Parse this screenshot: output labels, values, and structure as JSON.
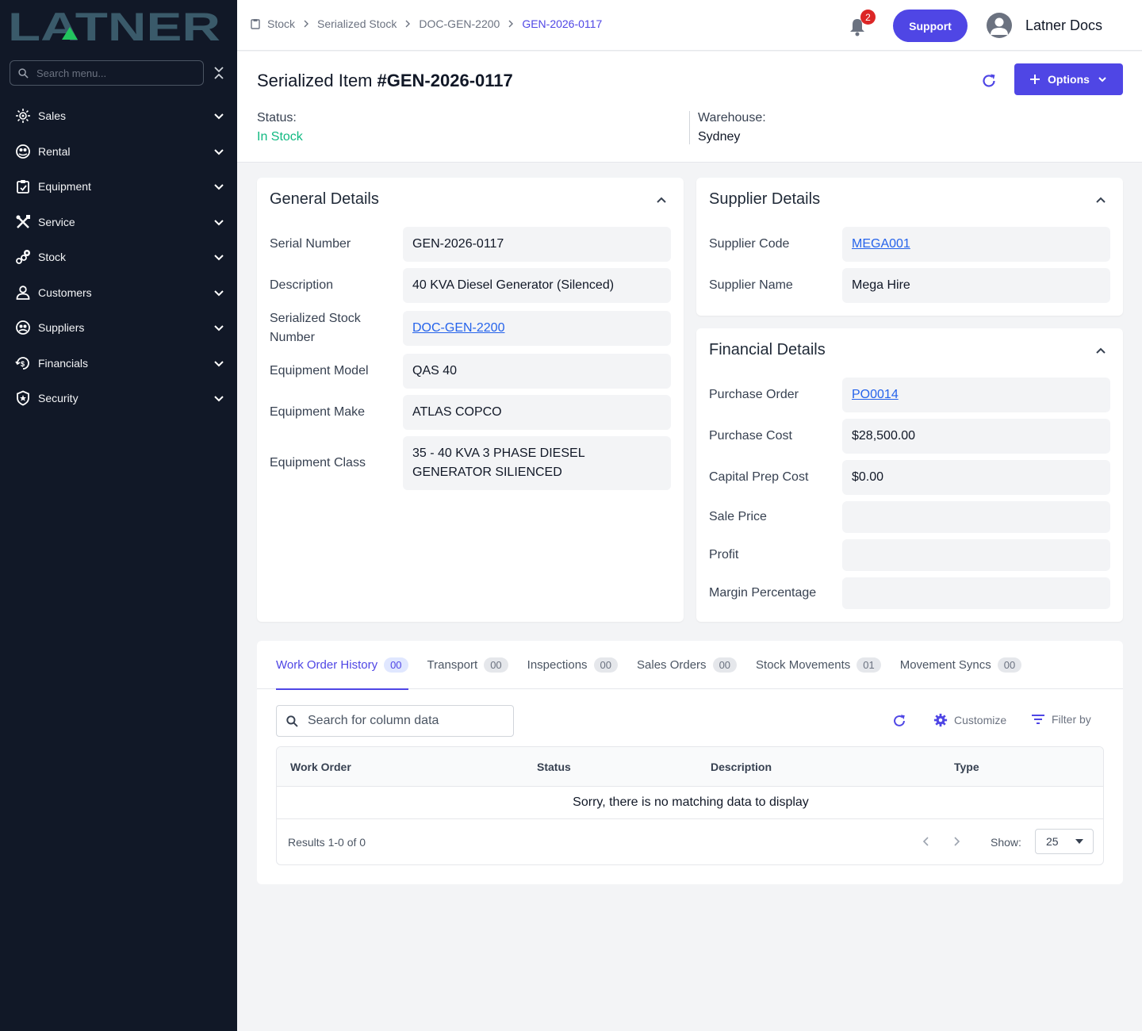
{
  "app": {
    "logo_text": "LATNER",
    "menu_search_placeholder": "Search menu..."
  },
  "sidebar": {
    "items": [
      {
        "label": "Sales",
        "icon": "sales-icon"
      },
      {
        "label": "Rental",
        "icon": "rental-icon"
      },
      {
        "label": "Equipment",
        "icon": "equipment-icon"
      },
      {
        "label": "Service",
        "icon": "service-tools-icon"
      },
      {
        "label": "Stock",
        "icon": "stock-icon"
      },
      {
        "label": "Customers",
        "icon": "user-icon"
      },
      {
        "label": "Suppliers",
        "icon": "suppliers-icon"
      },
      {
        "label": "Financials",
        "icon": "financials-icon"
      },
      {
        "label": "Security",
        "icon": "shield-icon"
      }
    ]
  },
  "topbar": {
    "breadcrumb": [
      "Stock",
      "Serialized Stock",
      "DOC-GEN-2200",
      "GEN-2026-0117"
    ],
    "notification_count": "2",
    "support_label": "Support",
    "user_name": "Latner Docs"
  },
  "header": {
    "title": "Serialized Item",
    "number": "#GEN-2026-0117",
    "options_label": "Options",
    "status_label": "Status:",
    "status_value": "In Stock",
    "warehouse_label": "Warehouse:",
    "warehouse_value": "Sydney"
  },
  "general": {
    "title": "General Details",
    "fields": [
      {
        "label": "Serial Number",
        "value": "GEN-2026-0117"
      },
      {
        "label": "Description",
        "value": "40 KVA Diesel Generator (Silenced)"
      },
      {
        "label": "Serialized Stock Number",
        "value": "DOC-GEN-2200"
      },
      {
        "label": "Equipment Model",
        "value": "QAS 40"
      },
      {
        "label": "Equipment Make",
        "value": "ATLAS COPCO"
      },
      {
        "label": "Equipment Class",
        "value": "35 - 40 KVA 3 PHASE DIESEL GENERATOR SILIENCED"
      }
    ]
  },
  "supplier": {
    "title": "Supplier Details",
    "fields": [
      {
        "label": "Supplier Code",
        "value": "MEGA001"
      },
      {
        "label": "Supplier Name",
        "value": "Mega Hire"
      }
    ]
  },
  "financial": {
    "title": "Financial Details",
    "fields": [
      {
        "label": "Purchase Order",
        "value": "PO0014"
      },
      {
        "label": "Purchase Cost",
        "value": "$28,500.00"
      },
      {
        "label": "Capital Prep Cost",
        "value": "$0.00"
      },
      {
        "label": "Sale Price",
        "value": ""
      },
      {
        "label": "Profit",
        "value": ""
      },
      {
        "label": "Margin Percentage",
        "value": ""
      }
    ]
  },
  "tabs": [
    {
      "label": "Work Order History",
      "count": "00"
    },
    {
      "label": "Transport",
      "count": "00"
    },
    {
      "label": "Inspections",
      "count": "00"
    },
    {
      "label": "Sales Orders",
      "count": "00"
    },
    {
      "label": "Stock Movements",
      "count": "01"
    },
    {
      "label": "Movement Syncs",
      "count": "00"
    }
  ],
  "table": {
    "search_placeholder": "Search for column data",
    "customize_label": "Customize",
    "filter_label": "Filter by",
    "columns": [
      "Work Order",
      "Status",
      "Description",
      "Type"
    ],
    "empty_message": "Sorry, there is no matching data to display",
    "results_text": "Results 1-0 of 0",
    "show_label": "Show:",
    "page_size": "25"
  },
  "colors": {
    "sidebar_bg": "#111827",
    "accent": "#4f46e5",
    "status_green": "#10b981",
    "link": "#2563eb",
    "badge_red": "#dc2626"
  }
}
